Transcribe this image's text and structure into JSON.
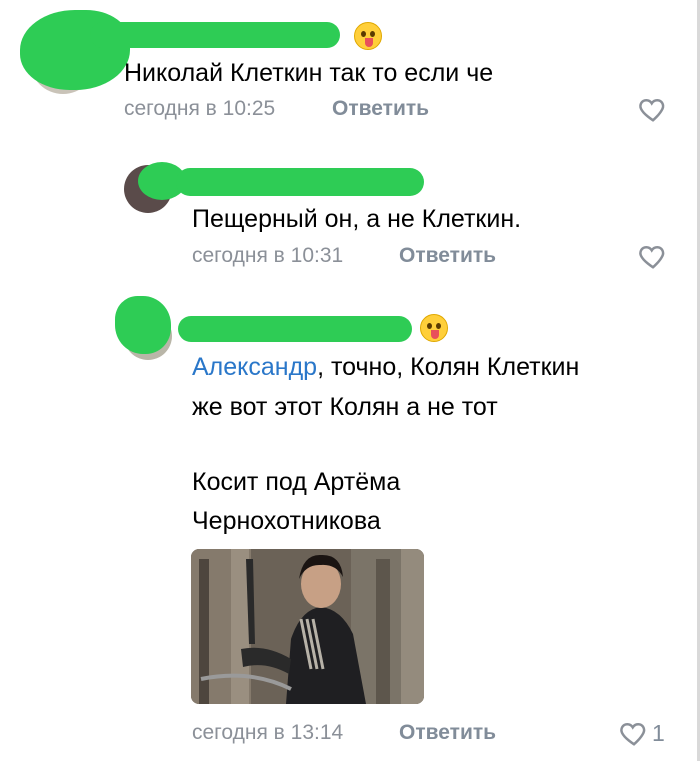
{
  "comments": [
    {
      "text": "Николай Клеткин так то если че",
      "time": "сегодня в 10:25",
      "reply": "Ответить"
    },
    {
      "text": "Пещерный он, а не Клеткин.",
      "time": "сегодня в 10:31",
      "reply": "Ответить"
    },
    {
      "mention": "Александр",
      "text_line1_rest": ", точно, Колян Клеткин",
      "text_line2": "же вот этот Колян а не тот",
      "text_line3": "Косит под Артёма",
      "text_line4": "Чернохотникова",
      "time": "сегодня в 13:14",
      "reply": "Ответить",
      "likes": "1"
    }
  ],
  "icons": {
    "like": "heart-outline-icon",
    "emoji": "zany-face-emoji"
  },
  "colors": {
    "redaction": "#2ecc55",
    "mention": "#2a77c9",
    "meta": "#8b9098",
    "reply": "#818c99"
  }
}
